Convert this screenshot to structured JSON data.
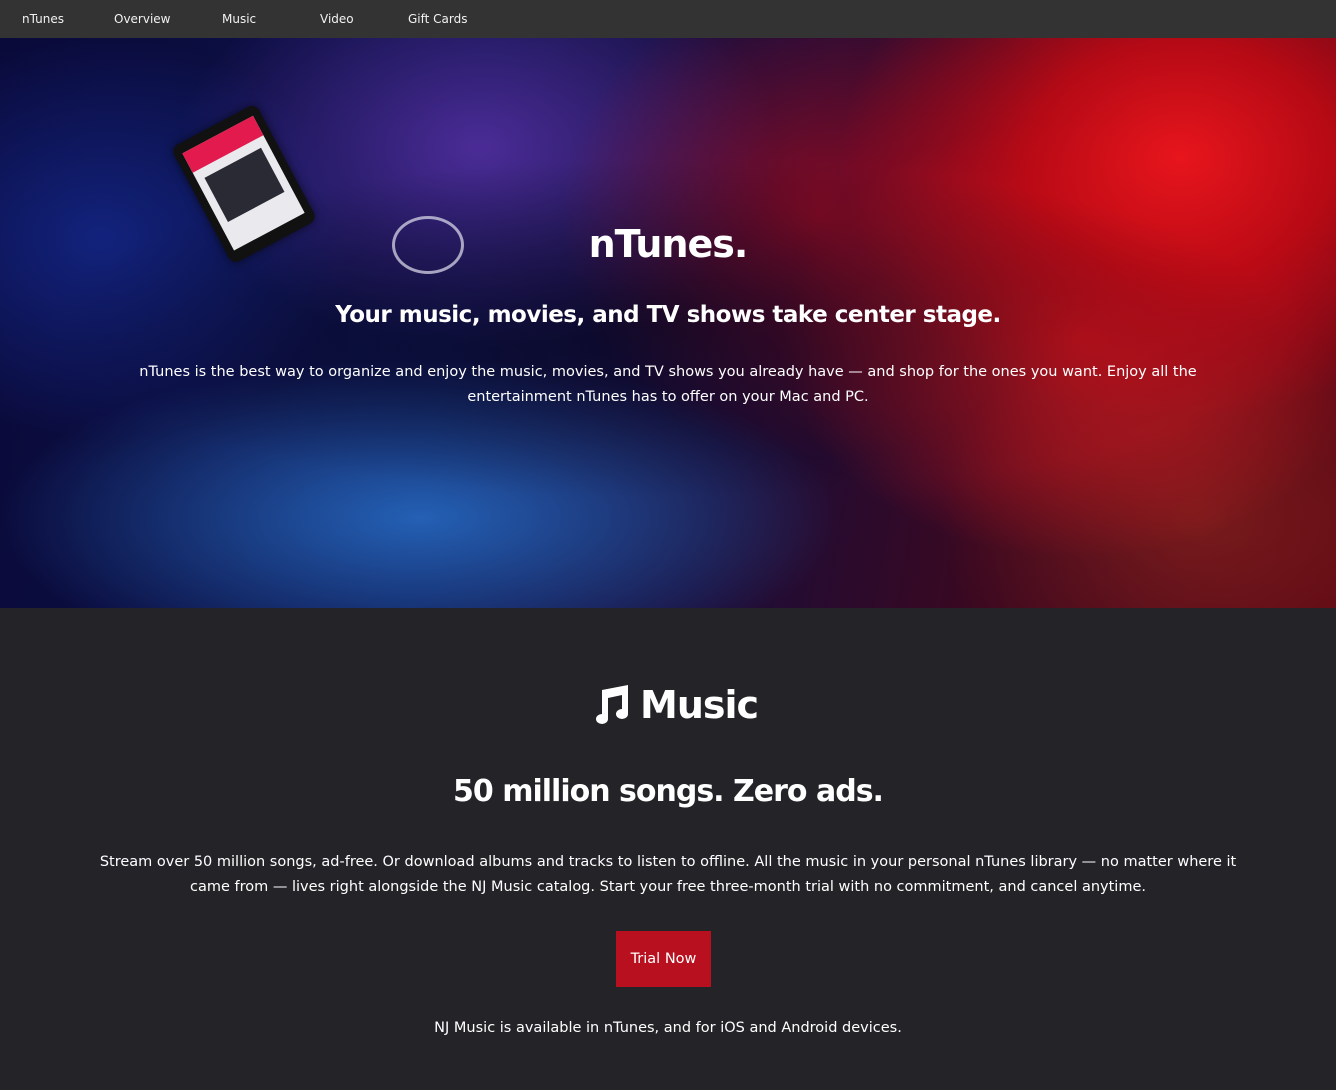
{
  "nav": {
    "items": [
      {
        "label": "nTunes"
      },
      {
        "label": "Overview"
      },
      {
        "label": "Music"
      },
      {
        "label": "Video"
      },
      {
        "label": "Gift Cards"
      }
    ]
  },
  "hero": {
    "title": "nTunes.",
    "subtitle": "Your music, movies, and TV shows take center stage.",
    "text": "nTunes is the best way to organize and enjoy the music, movies, and TV shows you already have — and shop for the ones you want. Enjoy all the entertainment nTunes has to offer on your Mac and PC."
  },
  "music": {
    "icon": "music-note-icon",
    "title": "Music",
    "subtitle": "50 million songs. Zero ads.",
    "text": "Stream over 50 million songs, ad-free. Or download albums and tracks to listen to offline. All the music in your personal nTunes library — no matter where it came from — lives right alongside the NJ Music catalog. Start your free three-month trial with no commitment, and cancel anytime.",
    "button_label": "Trial Now",
    "availability": "NJ Music is available in nTunes, and for iOS and Android devices."
  },
  "colors": {
    "nav_bg": "#333333",
    "page_bg": "#242428",
    "accent": "#b8101f"
  }
}
